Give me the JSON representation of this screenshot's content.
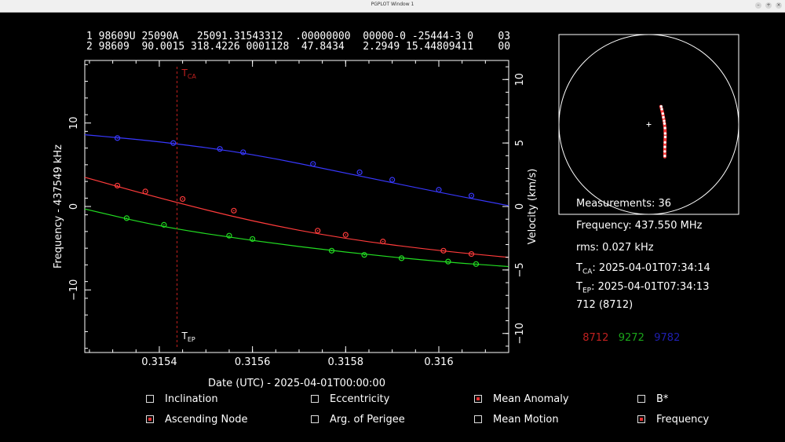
{
  "window": {
    "title": "PGPLOT Window 1",
    "buttons": [
      "–",
      "+",
      "×"
    ]
  },
  "tle": {
    "line1": "1 98609U 25090A   25091.31543312  .00000000  00000-0 -25444-3 0    03",
    "line2": "2 98609  90.0015 318.4226 0001128  47.8434   2.2949 15.44809411    00"
  },
  "info": {
    "measurements": "Measurements: 36",
    "frequency": "Frequency: 437.550 MHz",
    "rms": "rms: 0.027 kHz",
    "tca_label": "T",
    "tca_sub": "CA",
    "tca_value": ": 2025-04-01T07:34:14",
    "tep_label": "T",
    "tep_sub": "EP",
    "tep_value": ": 2025-04-01T07:34:13",
    "station": "712 (8712)"
  },
  "legend": [
    {
      "label": "8712",
      "color": "#c0201f"
    },
    {
      "label": "9272",
      "color": "#1aa51a"
    },
    {
      "label": "9782",
      "color": "#1f1fb0"
    }
  ],
  "params": [
    {
      "label": "Inclination",
      "checked": false
    },
    {
      "label": "Eccentricity",
      "checked": false
    },
    {
      "label": "Mean Anomaly",
      "checked": true
    },
    {
      "label": "B*",
      "checked": false
    },
    {
      "label": "Ascending Node",
      "checked": true
    },
    {
      "label": "Arg. of Perigee",
      "checked": false
    },
    {
      "label": "Mean Motion",
      "checked": false
    },
    {
      "label": "Frequency",
      "checked": true
    }
  ],
  "colors": {
    "background": "#000000",
    "axes": "#ffffff",
    "tca_line": "#c0201f"
  },
  "chart_data": {
    "type": "scatter",
    "xlabel": "Date (UTC) - 2025-04-01T00:00:00",
    "ylabel": "Frequency - 437549 kHz",
    "y2label": "Velocity (km/s)",
    "xlim": [
      0.31524,
      0.31615
    ],
    "ylim": [
      -17.5,
      17.5
    ],
    "y2lim": [
      -11.5,
      11.5
    ],
    "xticks": [
      0.3154,
      0.3156,
      0.3158,
      0.316
    ],
    "xtick_labels": [
      "0.3154",
      "0.3156",
      "0.3158",
      "0.316"
    ],
    "yticks": [
      10,
      0,
      -10
    ],
    "ytick_labels": [
      "10",
      "0",
      "−10"
    ],
    "y2ticks": [
      10,
      5,
      0,
      -5,
      -10
    ],
    "y2tick_labels": [
      "10",
      "5",
      "0",
      "−5",
      "−10"
    ],
    "tca_x": 0.315438,
    "tca_label": "T",
    "tca_sub": "CA",
    "tep_label": "T",
    "tep_sub": "EP",
    "series": [
      {
        "color": "#3838ff",
        "curve": [
          [
            0.31524,
            8.6
          ],
          [
            0.3154,
            7.8
          ],
          [
            0.3156,
            6.3
          ],
          [
            0.3158,
            4.0
          ],
          [
            0.316,
            1.7
          ],
          [
            0.31615,
            0.1
          ]
        ],
        "points": [
          [
            0.31531,
            8.2
          ],
          [
            0.31543,
            7.6
          ],
          [
            0.31553,
            6.9
          ],
          [
            0.31558,
            6.5
          ],
          [
            0.31573,
            5.1
          ],
          [
            0.31583,
            4.1
          ],
          [
            0.3159,
            3.2
          ],
          [
            0.316,
            2.0
          ],
          [
            0.31607,
            1.3
          ]
        ]
      },
      {
        "color": "#ff3b3b",
        "curve": [
          [
            0.31524,
            3.5
          ],
          [
            0.3154,
            1.0
          ],
          [
            0.3156,
            -1.8
          ],
          [
            0.3158,
            -3.9
          ],
          [
            0.316,
            -5.3
          ],
          [
            0.31615,
            -6.1
          ]
        ],
        "points": [
          [
            0.31531,
            2.5
          ],
          [
            0.31537,
            1.8
          ],
          [
            0.31545,
            0.9
          ],
          [
            0.31556,
            -0.5
          ],
          [
            0.31574,
            -2.9
          ],
          [
            0.3158,
            -3.4
          ],
          [
            0.31588,
            -4.2
          ],
          [
            0.31601,
            -5.3
          ],
          [
            0.31607,
            -5.7
          ]
        ]
      },
      {
        "color": "#22dd22",
        "curve": [
          [
            0.31524,
            -0.3
          ],
          [
            0.3154,
            -2.4
          ],
          [
            0.3156,
            -4.1
          ],
          [
            0.3158,
            -5.5
          ],
          [
            0.316,
            -6.6
          ],
          [
            0.31615,
            -7.2
          ]
        ],
        "points": [
          [
            0.31533,
            -1.4
          ],
          [
            0.31541,
            -2.2
          ],
          [
            0.31555,
            -3.5
          ],
          [
            0.3156,
            -3.9
          ],
          [
            0.31577,
            -5.3
          ],
          [
            0.31584,
            -5.8
          ],
          [
            0.31592,
            -6.2
          ],
          [
            0.31602,
            -6.6
          ],
          [
            0.31608,
            -6.9
          ]
        ]
      }
    ],
    "skyplot": {
      "track_color": "#ff3b3b",
      "dot_color": "#ffffff",
      "track": [
        [
          0.135,
          0.2
        ],
        [
          0.155,
          0.12
        ],
        [
          0.17,
          0.04
        ],
        [
          0.18,
          -0.04
        ],
        [
          0.183,
          -0.12
        ],
        [
          0.18,
          -0.2
        ],
        [
          0.178,
          -0.28
        ],
        [
          0.178,
          -0.36
        ]
      ],
      "dots": [
        [
          0.138,
          0.2
        ],
        [
          0.145,
          0.17
        ],
        [
          0.156,
          0.12
        ],
        [
          0.162,
          0.08
        ],
        [
          0.17,
          0.04
        ],
        [
          0.175,
          0.01
        ],
        [
          0.18,
          -0.04
        ],
        [
          0.182,
          -0.1
        ],
        [
          0.183,
          -0.14
        ],
        [
          0.18,
          -0.2
        ],
        [
          0.179,
          -0.25
        ],
        [
          0.178,
          -0.3
        ],
        [
          0.178,
          -0.35
        ]
      ]
    }
  }
}
